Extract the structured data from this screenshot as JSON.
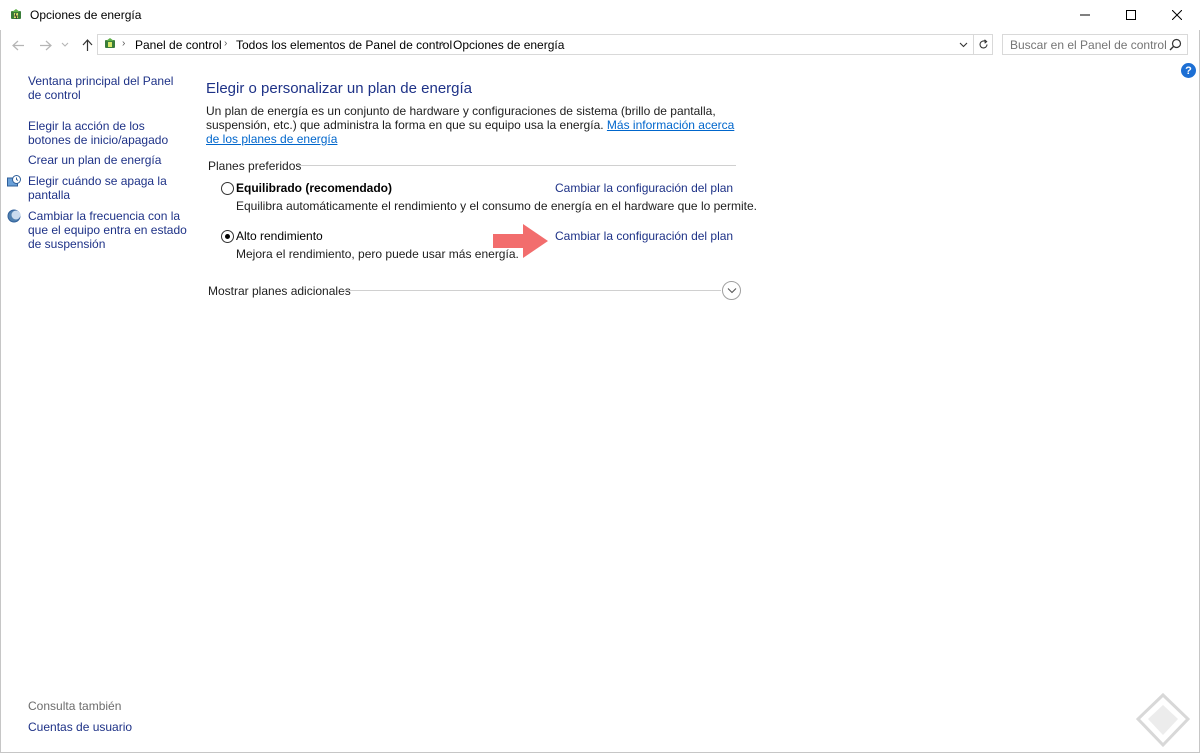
{
  "window": {
    "title": "Opciones de energía"
  },
  "address": {
    "crumbs": [
      "Panel de control",
      "Todos los elementos de Panel de control",
      "Opciones de energía"
    ],
    "search_placeholder": "Buscar en el Panel de control"
  },
  "leftnav": {
    "items": [
      "Ventana principal del Panel de control",
      "Elegir la acción de los botones de inicio/apagado",
      "Crear un plan de energía",
      "Elegir cuándo se apaga la pantalla",
      "Cambiar la frecuencia con la que el equipo entra en estado de suspensión"
    ],
    "see_also": "Consulta también",
    "user_accounts": "Cuentas de usuario"
  },
  "main": {
    "help": "?",
    "title": "Elegir o personalizar un plan de energía",
    "intro_text": "Un plan de energía es un conjunto de hardware y configuraciones de sistema (brillo de pantalla, suspensión, etc.) que administra la forma en que su equipo usa la energía. ",
    "intro_link": "Más información acerca de los planes de energía",
    "preferred_label": "Planes preferidos",
    "plans": [
      {
        "name": "Equilibrado (recomendado)",
        "description": "Equilibra automáticamente el rendimiento y el consumo de energía en el hardware que lo permite.",
        "link": "Cambiar la configuración del plan",
        "selected": false
      },
      {
        "name": "Alto rendimiento",
        "description": "Mejora el rendimiento, pero puede usar más energía.",
        "link": "Cambiar la configuración del plan",
        "selected": true
      }
    ],
    "more_plans": "Mostrar planes adicionales"
  },
  "colors": {
    "link": "#1e3287",
    "hyperlink": "#0066cc",
    "arrow": "#f26d6d",
    "help": "#1d6fd4"
  }
}
